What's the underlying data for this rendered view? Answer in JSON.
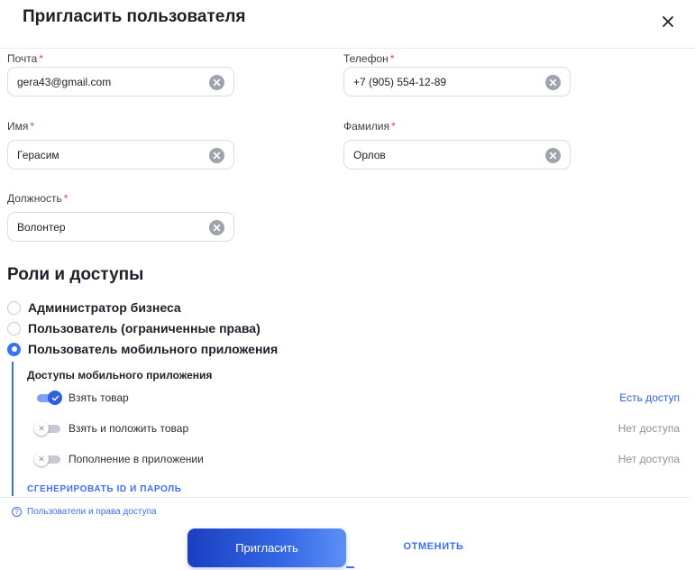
{
  "dialog": {
    "title": "Пригласить пользователя",
    "close_icon": "close-icon"
  },
  "fields": {
    "email": {
      "label": "Почта",
      "required_mark": "*",
      "value": "gera43@gmail.com"
    },
    "phone": {
      "label": "Телефон",
      "required_mark": "*",
      "value": "+7 (905) 554-12-89"
    },
    "first_name": {
      "label": "Имя",
      "required_mark": "*",
      "value": "Герасим"
    },
    "last_name": {
      "label": "Фамилия",
      "required_mark": "*",
      "value": "Орлов"
    },
    "position": {
      "label": "Должность",
      "required_mark": "*",
      "value": "Волонтер"
    }
  },
  "roles": {
    "title": "Роли и доступы",
    "options": [
      {
        "label": "Администратор бизнеса",
        "checked": false
      },
      {
        "label": "Пользователь (ограниченные права)",
        "checked": false
      },
      {
        "label": "Пользователь мобильного приложения",
        "checked": true
      }
    ]
  },
  "mobile_access": {
    "title": "Доступы мобильного приложения",
    "permissions": [
      {
        "label": "Взять товар",
        "enabled": true,
        "status": "Есть доступ"
      },
      {
        "label": "Взять и положить товар",
        "enabled": false,
        "status": "Нет доступа"
      },
      {
        "label": "Пополнение в приложении",
        "enabled": false,
        "status": "Нет доступа"
      }
    ],
    "generate_link": "СГЕНЕРИРОВАТЬ ID И ПАРОЛЬ"
  },
  "footer": {
    "help_link": "Пользователи и права доступа",
    "invite_button": "Пригласить",
    "cancel_button": "ОТМЕНИТЬ"
  },
  "colors": {
    "accent": "#3a6ff7",
    "required": "#e5484d",
    "status_muted": "#8b909a"
  }
}
